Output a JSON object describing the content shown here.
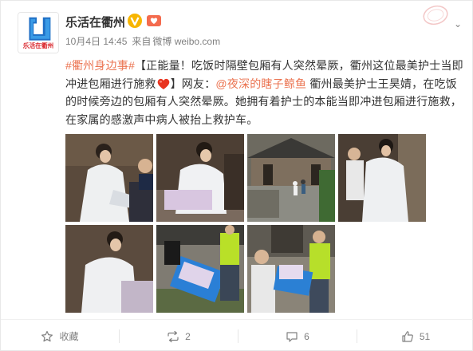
{
  "post": {
    "author": "乐活在衢州",
    "avatar_text": "乐活在衢州",
    "time": "10月4日 14:45",
    "source_prefix": "来自",
    "source": "微博 weibo.com",
    "content": {
      "hashtag": "#衢州身边事#",
      "part1": "【正能量！吃饭时隔壁包厢有人突然晕厥，衢州这位最美护士当即冲进包厢进行施救",
      "part2": "】网友：",
      "mention": "@夜深的瞎子鲸鱼",
      "part3": " 衢州最美护士王昊婧，在吃饭的时候旁边的包厢有人突然晕厥。她拥有着护士的本能当即冲进包厢进行施救，在家属的感激声中病人被抬上救护车。"
    },
    "photos": [
      {
        "name": "nurse-kneeling-photo"
      },
      {
        "name": "nurse-cpr-photo"
      },
      {
        "name": "courtyard-photo"
      },
      {
        "name": "nurse-standing-photo"
      },
      {
        "name": "nurse-closeup-photo"
      },
      {
        "name": "stretcher-photo"
      },
      {
        "name": "ambulance-carry-photo"
      }
    ],
    "actions": {
      "favorite": "收藏",
      "repost": "2",
      "comment": "6",
      "like": "51"
    }
  },
  "colors": {
    "link": "#eb7350",
    "meta": "#808080",
    "verified": "#f7b500"
  }
}
